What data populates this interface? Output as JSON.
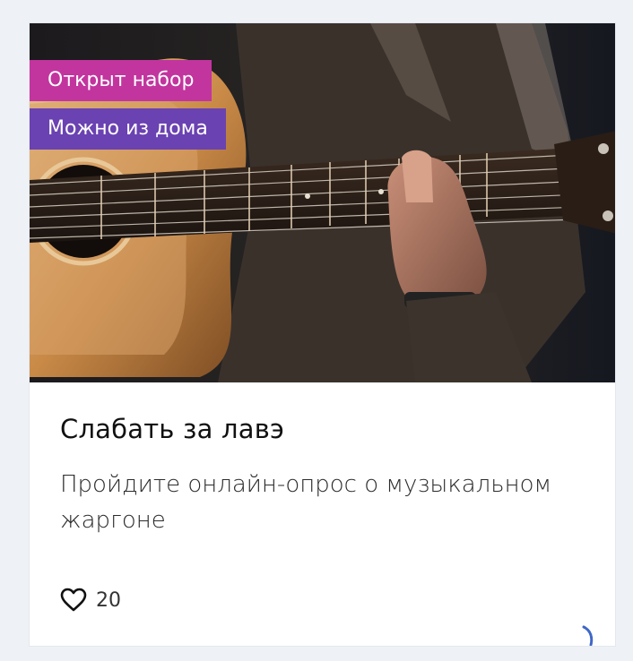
{
  "card": {
    "tags": [
      {
        "label": "Открыт набор",
        "color": "#c2359e"
      },
      {
        "label": "Можно из дома",
        "color": "#6a42b1"
      }
    ],
    "title": "Слабать за лавэ",
    "description": "Пройдите онлайн-опрос о музыкальном жаргоне",
    "likes": "20",
    "like_icon": "heart-outline-icon",
    "image_subject": "guitar-photo"
  },
  "colors": {
    "page_background": "#eef1f6",
    "card_background": "#ffffff",
    "tag_open": "#c2359e",
    "tag_home": "#6a42b1"
  }
}
